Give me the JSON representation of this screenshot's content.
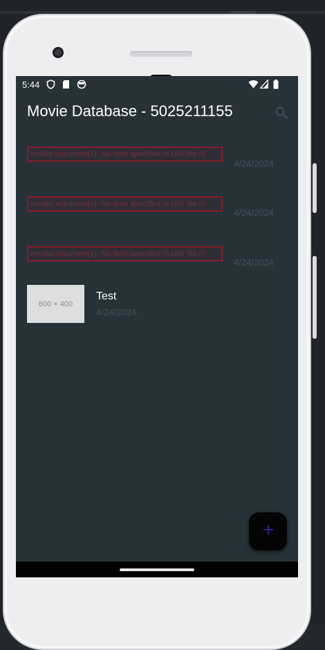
{
  "status_bar": {
    "time": "5:44",
    "left_icons": [
      "shield-icon",
      "sd-card-icon",
      "face-icon"
    ],
    "right_icons": [
      "wifi-icon",
      "signal-icon",
      "battery-icon"
    ]
  },
  "app_bar": {
    "title": "Movie Database - 5025211155",
    "search_icon": "search-icon"
  },
  "list": {
    "items": [
      {
        "error_text": "Invalid argument(s): No host specified in URI file:///",
        "date": "4/24/2024"
      },
      {
        "error_text": "Invalid argument(s): No host specified in URI file:///",
        "date": "4/24/2024"
      },
      {
        "error_text": "Invalid argument(s): No host specified in URI file:///",
        "date": "4/24/2024"
      }
    ],
    "movie": {
      "thumbnail_text": "600 × 400",
      "title": "Test",
      "date": "4/24/2024"
    }
  },
  "fab": {
    "icon": "plus-icon",
    "icon_color": "#3b1f8f"
  },
  "colors": {
    "screen_bg": "#263238",
    "error_border": "#8d1a2a",
    "muted_text": "#44515a"
  }
}
